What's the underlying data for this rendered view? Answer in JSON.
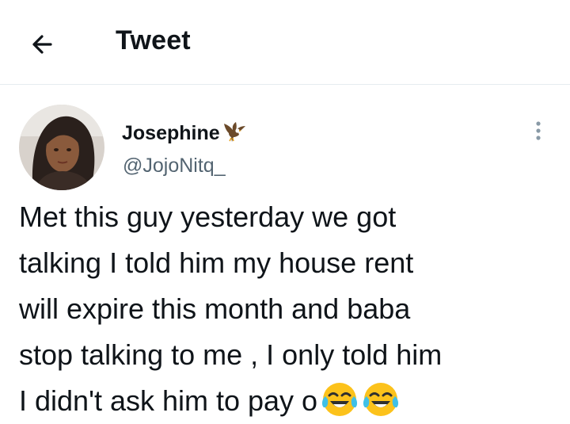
{
  "header": {
    "title": "Tweet",
    "back_icon": "arrow-left-icon"
  },
  "tweet": {
    "author": {
      "display_name": "Josephine",
      "badge_icon": "eagle-emoji-icon",
      "handle": "@JojoNitq_",
      "avatar_icon": "profile-photo"
    },
    "more_icon": "more-vertical-icon",
    "text": "Met this guy yesterday we got\ntalking I told him my house rent\nwill expire this month and baba\nstop talking to me , I only told him\nI didn't ask him to pay o",
    "trailing_emojis": [
      "face-with-tears-of-joy",
      "face-with-tears-of-joy"
    ]
  },
  "colors": {
    "text_primary": "#0f1419",
    "text_secondary": "#536471",
    "divider": "#e6ecf0"
  }
}
